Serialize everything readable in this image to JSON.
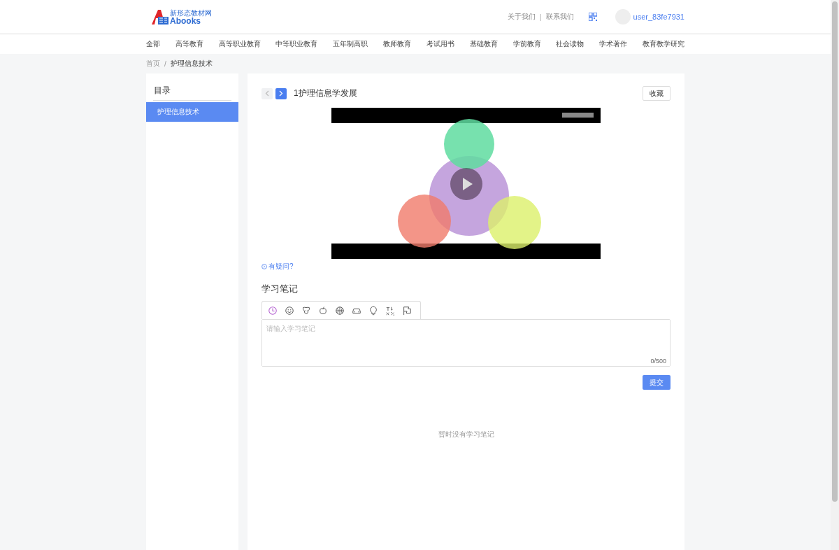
{
  "header": {
    "logo": {
      "subtitle": "新形态教材网",
      "title": "Abooks"
    },
    "links": [
      "关于我们",
      "联系我们"
    ],
    "link_separator": "|",
    "user": "user_83fe7931"
  },
  "nav": [
    {
      "label": "全部"
    },
    {
      "label": "高等教育"
    },
    {
      "label": "高等职业教育"
    },
    {
      "label": "中等职业教育"
    },
    {
      "label": "五年制高职"
    },
    {
      "label": "教师教育"
    },
    {
      "label": "考试用书"
    },
    {
      "label": "基础教育"
    },
    {
      "label": "学前教育"
    },
    {
      "label": "社会读物"
    },
    {
      "label": "学术著作"
    },
    {
      "label": "教育教学研究"
    }
  ],
  "breadcrumb": [
    "首页",
    "护理信息技术"
  ],
  "breadcrumb_separator": "/",
  "sidebar": {
    "title": "目录",
    "items": [
      {
        "label": "护理信息技术",
        "selected": true
      }
    ]
  },
  "lesson": {
    "prev_disabled": true,
    "next_disabled": false,
    "title": "1护理信息学发展",
    "favorite": "收藏",
    "question_link": "有疑问?"
  },
  "notes": {
    "title": "学习笔记",
    "emoji_tabs": [
      {
        "kind": "clock",
        "selected": true
      },
      {
        "kind": "smiley",
        "selected": false
      },
      {
        "kind": "dog",
        "selected": false
      },
      {
        "kind": "apple",
        "selected": false
      },
      {
        "kind": "ball",
        "selected": false
      },
      {
        "kind": "car",
        "selected": false
      },
      {
        "kind": "bulb",
        "selected": false
      },
      {
        "kind": "symbols",
        "selected": false
      },
      {
        "kind": "flag",
        "selected": false
      }
    ],
    "placeholder": "请输入学习笔记",
    "counter": "0/500",
    "submit": "提交",
    "empty": "暂时没有学习笔记"
  }
}
